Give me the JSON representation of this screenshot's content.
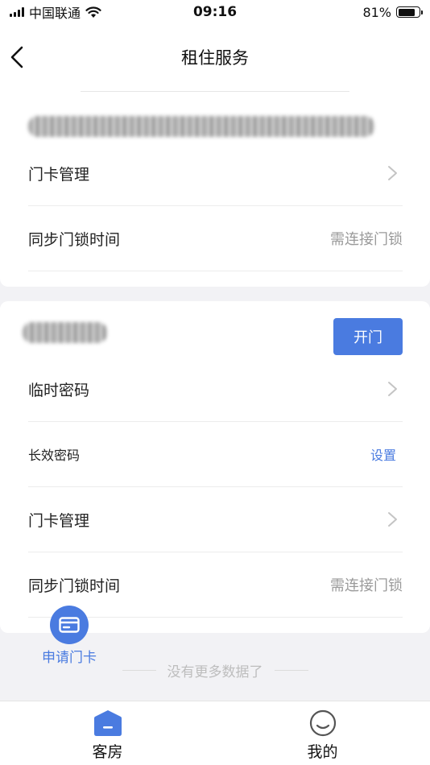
{
  "status_bar": {
    "carrier": "中国联通",
    "time": "09:16",
    "battery_percent": "81%",
    "battery_level": 0.81,
    "icons": [
      "signal-icon",
      "wifi-icon",
      "battery-icon"
    ]
  },
  "nav": {
    "title": "租住服务",
    "back_icon": "chevron-left-icon"
  },
  "card1": {
    "rows": [
      {
        "label": "门卡管理",
        "trailing": "chevron-right-icon"
      },
      {
        "label": "同步门锁时间",
        "value": "需连接门锁"
      }
    ]
  },
  "card2": {
    "open_button": "开门",
    "rows": [
      {
        "label": "临时密码",
        "trailing": "chevron-right-icon"
      },
      {
        "label": "长效密码",
        "link": "设置"
      },
      {
        "label": "门卡管理",
        "trailing": "chevron-right-icon"
      },
      {
        "label": "同步门锁时间",
        "value": "需连接门锁"
      }
    ]
  },
  "fab": {
    "label": "申请门卡",
    "icon": "card-icon"
  },
  "list_footer": {
    "text": "没有更多数据了"
  },
  "tabs": [
    {
      "label": "客房",
      "icon": "room-icon",
      "active": true
    },
    {
      "label": "我的",
      "icon": "smiley-icon",
      "active": false
    }
  ],
  "colors": {
    "accent": "#4a7be0",
    "muted": "#9a9a9a",
    "background": "#f2f2f5"
  }
}
